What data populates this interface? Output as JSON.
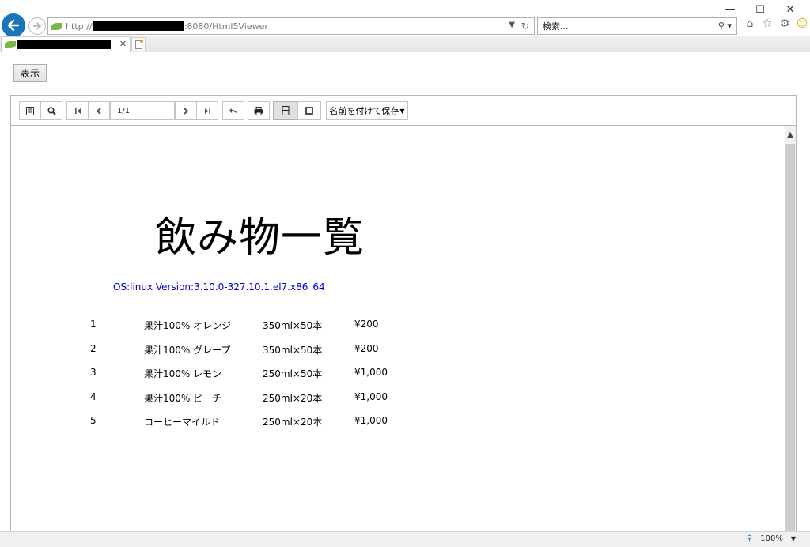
{
  "browser": {
    "url_prefix": "http://",
    "url_suffix": ":8080/Html5Viewer",
    "search_placeholder": "検索...",
    "zoom": "100%"
  },
  "page": {
    "show_button": "表示"
  },
  "viewer": {
    "page_indicator": "1/1",
    "save_label": "名前を付けて保存"
  },
  "document": {
    "title": "飲み物一覧",
    "os_line": "OS:linux Version:3.10.0-327.10.1.el7.x86_64",
    "rows": [
      {
        "no": "1",
        "name": "果汁100% オレンジ",
        "size": "350ml×50本",
        "price": "¥200"
      },
      {
        "no": "2",
        "name": "果汁100% グレープ",
        "size": "350ml×50本",
        "price": "¥200"
      },
      {
        "no": "3",
        "name": "果汁100% レモン",
        "size": "250ml×50本",
        "price": "¥1,000"
      },
      {
        "no": "4",
        "name": "果汁100% ピーチ",
        "size": "250ml×20本",
        "price": "¥1,000"
      },
      {
        "no": "5",
        "name": "コーヒーマイルド",
        "size": "250ml×20本",
        "price": "¥1,000"
      }
    ]
  }
}
